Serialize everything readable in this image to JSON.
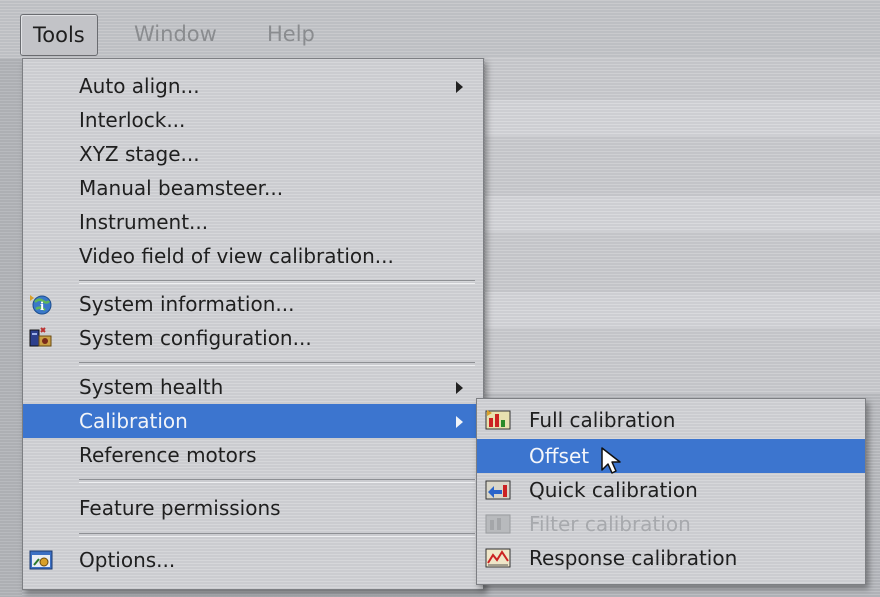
{
  "menubar": {
    "items": [
      "Tools",
      "Window",
      "Help"
    ]
  },
  "tools_menu": {
    "items": [
      {
        "label": "Auto align...",
        "submenu": true
      },
      {
        "label": "Interlock..."
      },
      {
        "label": "XYZ stage..."
      },
      {
        "label": "Manual beamsteer..."
      },
      {
        "label": "Instrument..."
      },
      {
        "label": "Video field of view calibration..."
      },
      {
        "label": "System information...",
        "icon": "globe-info-icon"
      },
      {
        "label": "System configuration...",
        "icon": "system-config-icon"
      },
      {
        "label": "System health",
        "submenu": true
      },
      {
        "label": "Calibration",
        "submenu": true,
        "selected": true
      },
      {
        "label": "Reference motors"
      },
      {
        "label": "Feature permissions"
      },
      {
        "label": "Options...",
        "icon": "options-icon"
      }
    ]
  },
  "calibration_submenu": {
    "items": [
      {
        "label": "Full calibration",
        "icon": "full-calibration-icon"
      },
      {
        "label": "Offset",
        "selected": true
      },
      {
        "label": "Quick calibration",
        "icon": "quick-calibration-icon"
      },
      {
        "label": "Filter calibration",
        "icon": "filter-calibration-icon",
        "disabled": true
      },
      {
        "label": "Response calibration",
        "icon": "response-calibration-icon"
      }
    ]
  },
  "colors": {
    "selection": "#3c75cf",
    "menu_bg": "#d3d4d7",
    "disabled_text": "#a7a9ad"
  }
}
